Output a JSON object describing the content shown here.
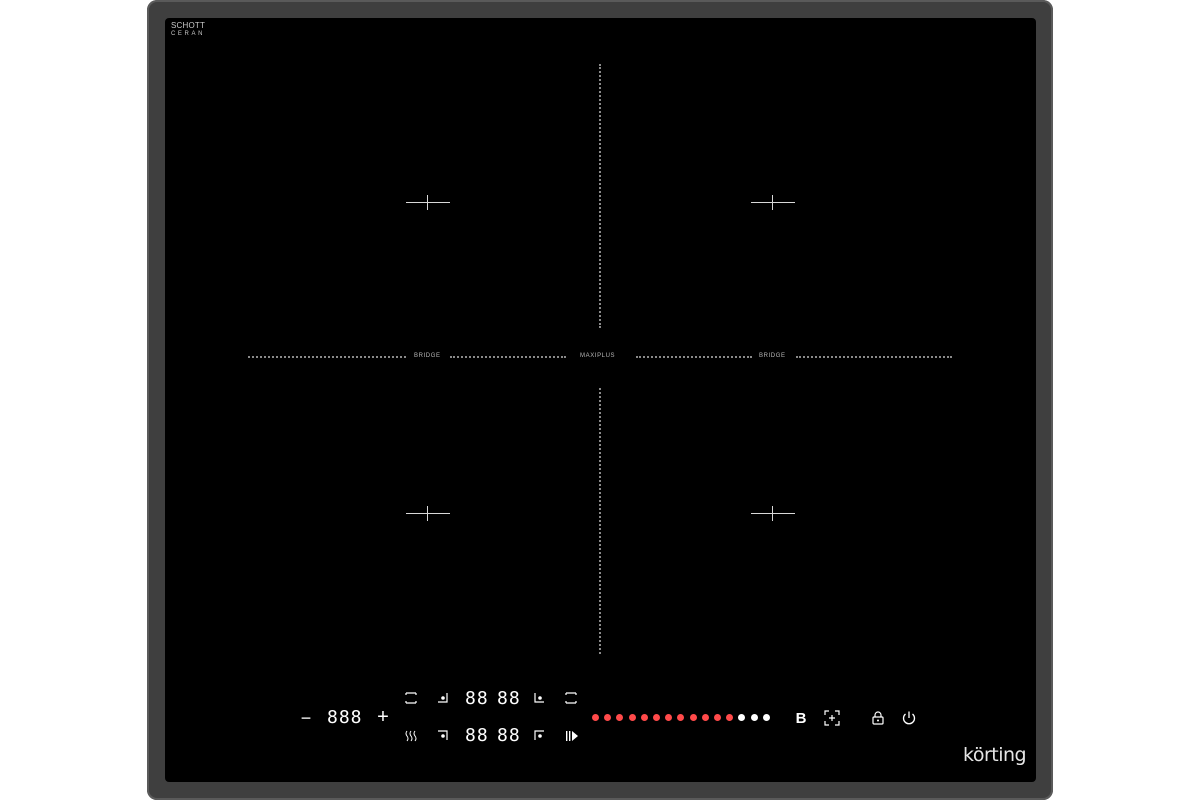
{
  "brand": {
    "glass_line1": "SCHOTT",
    "glass_line2": "CERAN",
    "logo": "körting"
  },
  "zones": {
    "bridge_left": "BRIDGE",
    "maxiplus": "MAXIPLUS",
    "bridge_right": "BRIDGE"
  },
  "controls": {
    "minus": "−",
    "plus": "+",
    "timer_display": "888",
    "display_top_left": "88",
    "display_top_right": "88",
    "display_bottom_left": "88",
    "display_bottom_right": "88",
    "bridge_button": "B"
  },
  "power_slider": {
    "total_levels": 15,
    "active_levels": 12,
    "active_color": "#ff4a4a",
    "inactive_color": "#ffffff"
  },
  "icons": {
    "zone_top_left": "zone-bracket-icon",
    "zone_top_right": "zone-bracket-icon",
    "keep_warm": "heat-waves-icon",
    "pause": "pause-play-icon",
    "lock": "lock-icon",
    "power": "power-icon",
    "boost": "boost-target-icon"
  }
}
